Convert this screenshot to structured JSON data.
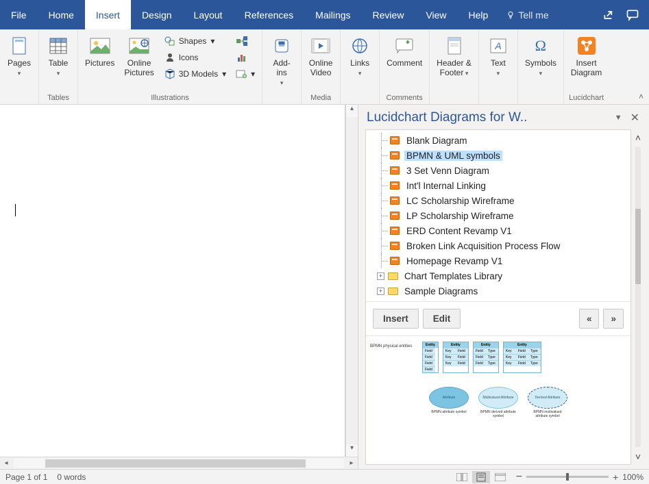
{
  "menu": {
    "tabs": [
      "File",
      "Home",
      "Insert",
      "Design",
      "Layout",
      "References",
      "Mailings",
      "Review",
      "View",
      "Help"
    ],
    "active_index": 2,
    "tellme": "Tell me"
  },
  "ribbon": {
    "groups": {
      "pages": {
        "label": "",
        "btn": "Pages"
      },
      "tables": {
        "label": "Tables",
        "btn": "Table"
      },
      "illustrations": {
        "label": "Illustrations",
        "pictures": "Pictures",
        "online_pictures": "Online\nPictures",
        "shapes": "Shapes",
        "icons": "Icons",
        "models": "3D Models",
        "smartart": "",
        "chart": "",
        "screenshot": ""
      },
      "addins": {
        "label": "",
        "btn": "Add-\nins"
      },
      "media": {
        "label": "Media",
        "btn": "Online\nVideo"
      },
      "links": {
        "label": "",
        "btn": "Links"
      },
      "comments": {
        "label": "Comments",
        "btn": "Comment"
      },
      "headerfooter": {
        "label": "",
        "btn": "Header &\nFooter"
      },
      "text": {
        "label": "",
        "btn": "Text"
      },
      "symbols": {
        "label": "",
        "btn": "Symbols"
      },
      "lucid": {
        "label": "Lucidchart",
        "btn": "Insert\nDiagram"
      }
    }
  },
  "panel": {
    "title": "Lucidchart Diagrams for W..",
    "tree": {
      "docs": [
        "Blank Diagram",
        "BPMN & UML symbols",
        "3 Set Venn Diagram",
        "Int'l Internal Linking",
        "LC Scholarship Wireframe",
        "LP Scholarship Wireframe",
        "ERD Content Revamp V1",
        "Broken Link Acquisition Process Flow",
        "Homepage Revamp V1"
      ],
      "selected_index": 1,
      "folders": [
        "Chart Templates Library",
        "Sample Diagrams"
      ]
    },
    "buttons": {
      "insert": "Insert",
      "edit": "Edit",
      "prev": "«",
      "next": "»"
    },
    "preview": {
      "row1_label": "BPMN physical entities",
      "table_header": "Entity",
      "table_keys": [
        "Field",
        "Field",
        "Field",
        "Field"
      ],
      "el1": "Attribute",
      "el2": "Multivalued\nAttribute",
      "el3": "Derived\nAttribute",
      "cap1": "BPMN attribute symbol",
      "cap2": "BPMN derived attribute symbol",
      "cap3": "BPMN multivalued attribute symbol"
    }
  },
  "status": {
    "page": "Page 1 of 1",
    "words": "0 words",
    "zoom": "100%"
  }
}
